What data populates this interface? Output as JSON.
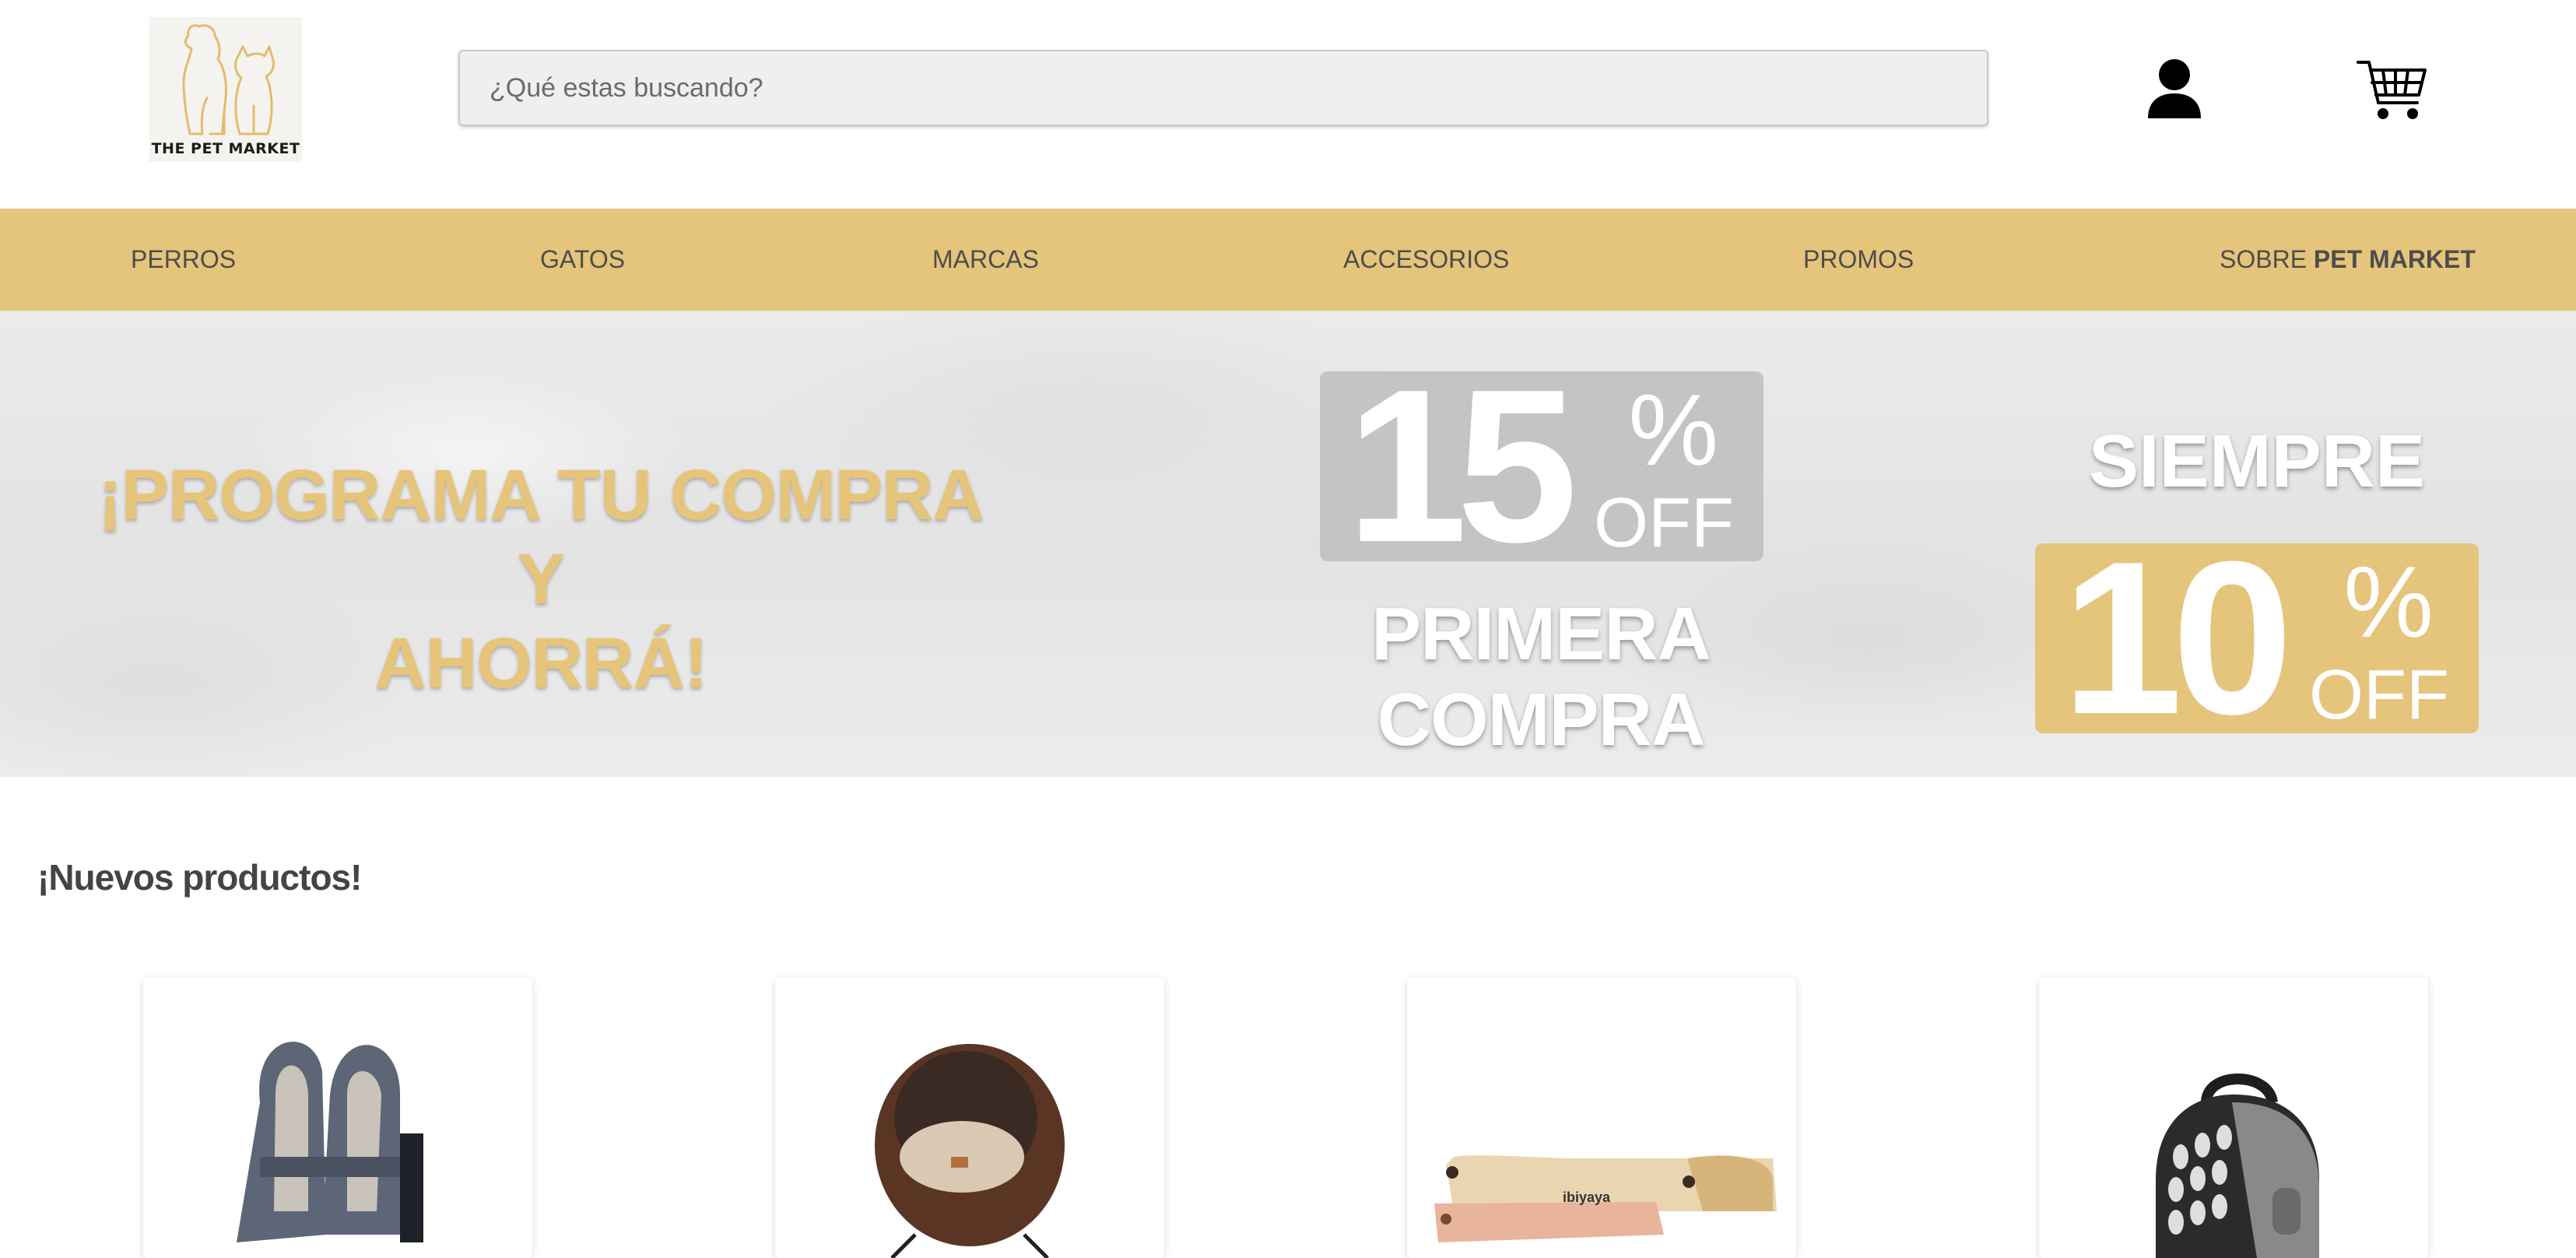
{
  "header": {
    "logo_text": "THE PET MARKET",
    "search_placeholder": "¿Qué estas buscando?",
    "icons": [
      "user-icon",
      "cart-icon"
    ]
  },
  "nav": {
    "items": [
      "PERROS",
      "GATOS",
      "MARCAS",
      "ACCESORIOS",
      "PROMOS"
    ],
    "about_prefix": "SOBRE",
    "about_bold": "PET MARKET"
  },
  "banner": {
    "headline_line1": "¡PROGRAMA TU COMPRA Y",
    "headline_line2": "AHORRÁ!",
    "offer1_number": "15",
    "offer1_percent": "%",
    "offer1_off": "OFF",
    "offer1_caption": "PRIMERA COMPRA",
    "offer2_caption": "SIEMPRE",
    "offer2_number": "10",
    "offer2_percent": "%",
    "offer2_off": "OFF"
  },
  "products": {
    "title": "¡Nuevos productos!",
    "items": [
      {
        "image": "dog-harness-carrier"
      },
      {
        "image": "cat-bed-sphere"
      },
      {
        "image": "ibiyaya-cat-scratcher",
        "brand_text": "ibiyaya"
      },
      {
        "image": "pet-backpack-carrier"
      }
    ]
  },
  "colors": {
    "accent": "#e5c47b",
    "gray_box": "#c4c4c4",
    "text": "#4a4a4a"
  }
}
